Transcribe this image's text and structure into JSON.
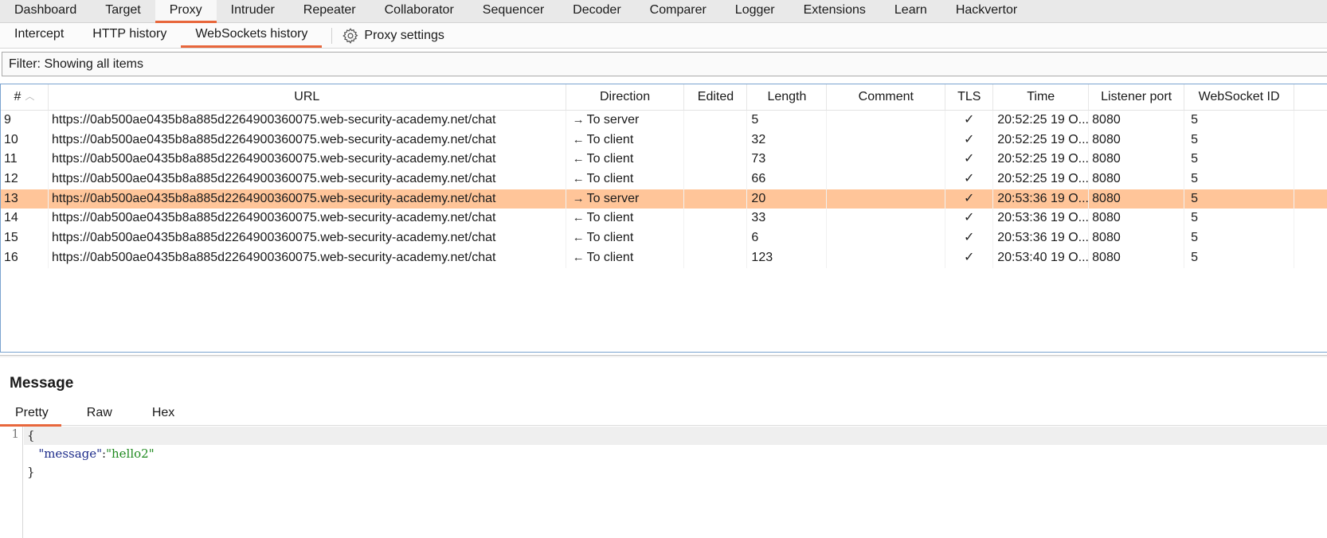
{
  "top_tabs": [
    {
      "label": "Dashboard",
      "active": false
    },
    {
      "label": "Target",
      "active": false
    },
    {
      "label": "Proxy",
      "active": true
    },
    {
      "label": "Intruder",
      "active": false
    },
    {
      "label": "Repeater",
      "active": false
    },
    {
      "label": "Collaborator",
      "active": false
    },
    {
      "label": "Sequencer",
      "active": false
    },
    {
      "label": "Decoder",
      "active": false
    },
    {
      "label": "Comparer",
      "active": false
    },
    {
      "label": "Logger",
      "active": false
    },
    {
      "label": "Extensions",
      "active": false
    },
    {
      "label": "Learn",
      "active": false
    },
    {
      "label": "Hackvertor",
      "active": false
    }
  ],
  "sub_tabs": [
    {
      "label": "Intercept",
      "active": false
    },
    {
      "label": "HTTP history",
      "active": false
    },
    {
      "label": "WebSockets history",
      "active": true
    }
  ],
  "proxy_settings": {
    "label": "Proxy settings",
    "icon": "gear-icon"
  },
  "filter": {
    "text": "Filter: Showing all items"
  },
  "table": {
    "columns": [
      "#",
      "URL",
      "Direction",
      "Edited",
      "Length",
      "Comment",
      "TLS",
      "Time",
      "Listener port",
      "WebSocket ID"
    ],
    "sort": {
      "column": "#",
      "direction": "ascending"
    },
    "selected_row": 13,
    "rows": [
      {
        "num": "9",
        "url": "https://0ab500ae0435b8a885d2264900360075.web-security-academy.net/chat",
        "direction": "To server",
        "arrow": "→",
        "edited": "",
        "length": "5",
        "comment": "",
        "tls": "✓",
        "time": "20:52:25 19 O...",
        "port": "8080",
        "ws_id": "5"
      },
      {
        "num": "10",
        "url": "https://0ab500ae0435b8a885d2264900360075.web-security-academy.net/chat",
        "direction": "To client",
        "arrow": "←",
        "edited": "",
        "length": "32",
        "comment": "",
        "tls": "✓",
        "time": "20:52:25 19 O...",
        "port": "8080",
        "ws_id": "5"
      },
      {
        "num": "11",
        "url": "https://0ab500ae0435b8a885d2264900360075.web-security-academy.net/chat",
        "direction": "To client",
        "arrow": "←",
        "edited": "",
        "length": "73",
        "comment": "",
        "tls": "✓",
        "time": "20:52:25 19 O...",
        "port": "8080",
        "ws_id": "5"
      },
      {
        "num": "12",
        "url": "https://0ab500ae0435b8a885d2264900360075.web-security-academy.net/chat",
        "direction": "To client",
        "arrow": "←",
        "edited": "",
        "length": "66",
        "comment": "",
        "tls": "✓",
        "time": "20:52:25 19 O...",
        "port": "8080",
        "ws_id": "5"
      },
      {
        "num": "13",
        "url": "https://0ab500ae0435b8a885d2264900360075.web-security-academy.net/chat",
        "direction": "To server",
        "arrow": "→",
        "edited": "",
        "length": "20",
        "comment": "",
        "tls": "✓",
        "time": "20:53:36 19 O...",
        "port": "8080",
        "ws_id": "5"
      },
      {
        "num": "14",
        "url": "https://0ab500ae0435b8a885d2264900360075.web-security-academy.net/chat",
        "direction": "To client",
        "arrow": "←",
        "edited": "",
        "length": "33",
        "comment": "",
        "tls": "✓",
        "time": "20:53:36 19 O...",
        "port": "8080",
        "ws_id": "5"
      },
      {
        "num": "15",
        "url": "https://0ab500ae0435b8a885d2264900360075.web-security-academy.net/chat",
        "direction": "To client",
        "arrow": "←",
        "edited": "",
        "length": "6",
        "comment": "",
        "tls": "✓",
        "time": "20:53:36 19 O...",
        "port": "8080",
        "ws_id": "5"
      },
      {
        "num": "16",
        "url": "https://0ab500ae0435b8a885d2264900360075.web-security-academy.net/chat",
        "direction": "To client",
        "arrow": "←",
        "edited": "",
        "length": "123",
        "comment": "",
        "tls": "✓",
        "time": "20:53:40 19 O...",
        "port": "8080",
        "ws_id": "5"
      }
    ]
  },
  "message": {
    "title": "Message",
    "tabs": [
      {
        "label": "Pretty",
        "active": true
      },
      {
        "label": "Raw",
        "active": false
      },
      {
        "label": "Hex",
        "active": false
      }
    ],
    "line_numbers": [
      "1"
    ],
    "code": {
      "open": "{",
      "key": "\"message\"",
      "colon": ":",
      "value": "\"hello2\"",
      "close": "}"
    }
  },
  "colors": {
    "accent": "#e8673c",
    "selected_row": "#ffc599",
    "json_key": "#1c2b8a",
    "json_string": "#1f8a1f",
    "table_border": "#7aa3cf"
  }
}
